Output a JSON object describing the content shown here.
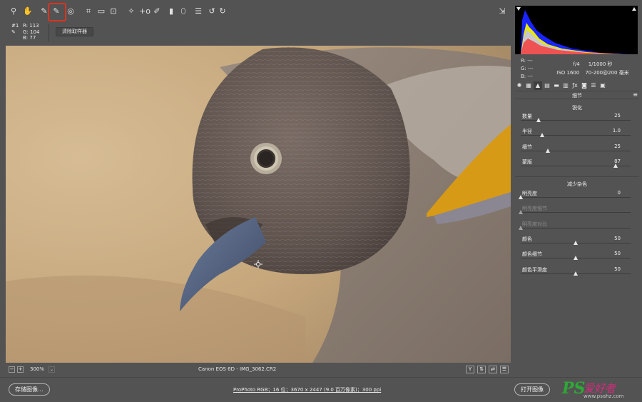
{
  "toolbar": {
    "tools": [
      {
        "name": "zoom-tool",
        "icon": "magnifier-icon",
        "glyph": "⚲"
      },
      {
        "name": "hand-tool",
        "icon": "hand-icon",
        "glyph": "✋"
      },
      {
        "name": "white-balance-tool",
        "icon": "eyedropper-icon",
        "glyph": "✎"
      },
      {
        "name": "color-sampler-tool",
        "icon": "color-sampler-icon",
        "glyph": "✎",
        "selected": true
      },
      {
        "name": "targeted-adjustment-tool",
        "icon": "target-adjust-icon",
        "glyph": "◎"
      },
      {
        "name": "crop-tool",
        "icon": "crop-icon",
        "glyph": "⌗"
      },
      {
        "name": "straighten-tool",
        "icon": "straighten-icon",
        "glyph": "▭"
      },
      {
        "name": "transform-tool",
        "icon": "transform-icon",
        "glyph": "⊡"
      },
      {
        "name": "spot-removal-tool",
        "icon": "spot-removal-icon",
        "glyph": "✧"
      },
      {
        "name": "red-eye-tool",
        "icon": "red-eye-icon",
        "glyph": "+o"
      },
      {
        "name": "adjustment-brush-tool",
        "icon": "brush-icon",
        "glyph": "✐"
      },
      {
        "name": "graduated-filter-tool",
        "icon": "graduated-filter-icon",
        "glyph": "▮"
      },
      {
        "name": "radial-filter-tool",
        "icon": "radial-filter-icon",
        "glyph": "⬯"
      },
      {
        "name": "preferences-tool",
        "icon": "list-icon",
        "glyph": "☰"
      },
      {
        "name": "rotate-left-tool",
        "icon": "rotate-ccw-icon",
        "glyph": "↺"
      },
      {
        "name": "rotate-right-tool",
        "icon": "rotate-cw-icon",
        "glyph": "↻"
      }
    ],
    "fullscreen_icon": "fullscreen-icon"
  },
  "sample": {
    "id": "#1",
    "r_label": "R:",
    "r_value": "113",
    "g_label": "G:",
    "g_value": "104",
    "b_label": "B:",
    "b_value": "77",
    "clear_button": "清除取样器"
  },
  "status": {
    "zoom": "300%",
    "file_info": "Canon EOS 6D -  IMG_3062.CR2",
    "view_buttons": [
      "Y",
      "⇅",
      "⇄",
      "☰"
    ]
  },
  "bottom": {
    "save_button": "存储图像...",
    "workflow": "ProPhoto RGB；16 位；3670 x 2447 (9.0 百万像素)；300 ppi",
    "open_button": "打开图像"
  },
  "watermark": {
    "ps": "PS",
    "cn": "爱好者",
    "url": "www.psahz.com"
  },
  "panel": {
    "readout": {
      "r": "R:  ---",
      "g": "G:  ---",
      "b": "B:  ---",
      "aperture": "f/4",
      "shutter": "1/1000 秒",
      "iso": "ISO 1600",
      "lens": "70-200@200 毫米"
    },
    "tabs": [
      {
        "name": "tab-basic",
        "glyph": "✺"
      },
      {
        "name": "tab-tone-curve",
        "glyph": "▦"
      },
      {
        "name": "tab-detail",
        "glyph": "▲",
        "active": true
      },
      {
        "name": "tab-hsl",
        "glyph": "▤"
      },
      {
        "name": "tab-split-toning",
        "glyph": "▬"
      },
      {
        "name": "tab-lens-corrections",
        "glyph": "▥"
      },
      {
        "name": "tab-effects",
        "glyph": "ƒx"
      },
      {
        "name": "tab-camera-calibration",
        "glyph": "◙"
      },
      {
        "name": "tab-presets",
        "glyph": "☰"
      },
      {
        "name": "tab-snapshots",
        "glyph": "▣"
      }
    ],
    "title": "细节",
    "sharpening": {
      "title": "锐化",
      "sliders": [
        {
          "label": "数量",
          "value": "25",
          "min": 0,
          "max": 150,
          "num": 25
        },
        {
          "label": "半径",
          "value": "1.0",
          "min": 0.5,
          "max": 3.0,
          "num": 1.0
        },
        {
          "label": "细节",
          "value": "25",
          "min": 0,
          "max": 100,
          "num": 25
        },
        {
          "label": "蒙版",
          "value": "87",
          "min": 0,
          "max": 100,
          "num": 87
        }
      ]
    },
    "noise": {
      "title": "减少杂色",
      "sliders": [
        {
          "label": "明亮度",
          "value": "0",
          "min": 0,
          "max": 100,
          "num": 0
        },
        {
          "label": "明亮度细节",
          "value": "",
          "min": 0,
          "max": 100,
          "num": 0,
          "disabled": true
        },
        {
          "label": "明亮度对比",
          "value": "",
          "min": 0,
          "max": 100,
          "num": 0,
          "disabled": true
        },
        {
          "label": "颜色",
          "value": "50",
          "min": 0,
          "max": 100,
          "num": 50
        },
        {
          "label": "颜色细节",
          "value": "50",
          "min": 0,
          "max": 100,
          "num": 50
        },
        {
          "label": "颜色平滑度",
          "value": "50",
          "min": 0,
          "max": 100,
          "num": 50
        }
      ]
    }
  },
  "colors": {
    "highlight_box": "#e0321e",
    "background": "#535353"
  }
}
